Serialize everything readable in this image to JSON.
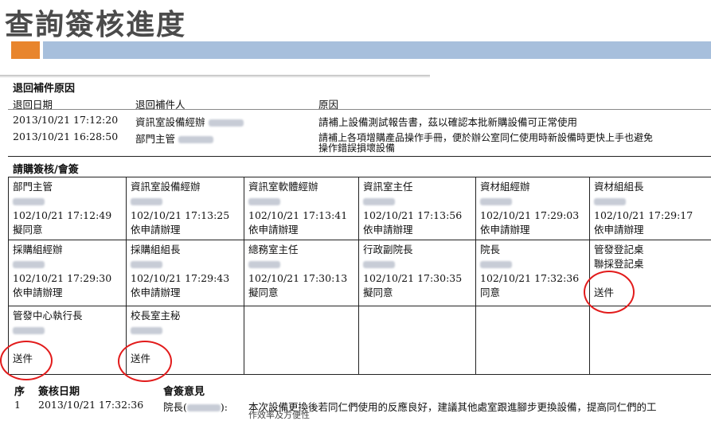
{
  "page_title": "查詢簽核進度",
  "return_section": {
    "heading": "退回補件原因",
    "headers": [
      "退回日期",
      "退回補件人",
      "原因"
    ],
    "rows": [
      {
        "date": "2013/10/21 17:12:20",
        "person": "資訊室設備經辦",
        "reason1": "請補上設備測試報告書，茲以確認本批新購設備可正常使用",
        "reason2": ""
      },
      {
        "date": "2013/10/21 16:28:50",
        "person": "部門主管",
        "reason1": "請補上各項增購產品操作手冊，便於辦公室同仁使用時新設備時更快上手也避免",
        "reason2": "操作錯誤損壞設備"
      }
    ]
  },
  "sign_section": {
    "heading": "請購簽核/會簽",
    "cells": [
      {
        "role": "部門主管",
        "time": "102/10/21 17:12:49",
        "result": "擬同意"
      },
      {
        "role": "資訊室設備經辦",
        "time": "102/10/21 17:13:25",
        "result": "依申請辦理"
      },
      {
        "role": "資訊室軟體經辦",
        "time": "102/10/21 17:13:41",
        "result": "依申請辦理"
      },
      {
        "role": "資訊室主任",
        "time": "102/10/21 17:13:56",
        "result": "依申請辦理"
      },
      {
        "role": "資材組經辦",
        "time": "102/10/21 17:29:03",
        "result": "依申請辦理"
      },
      {
        "role": "資材組組長",
        "time": "102/10/21 17:29:17",
        "result": "依申請辦理"
      },
      {
        "role": "採購組經辦",
        "time": "102/10/21 17:29:30",
        "result": "依申請辦理"
      },
      {
        "role": "採購組組長",
        "time": "102/10/21 17:29:43",
        "result": "依申請辦理"
      },
      {
        "role": "總務室主任",
        "time": "102/10/21 17:30:13",
        "result": "擬同意"
      },
      {
        "role": "行政副院長",
        "time": "102/10/21 17:30:35",
        "result": "擬同意"
      },
      {
        "role": "院長",
        "time": "102/10/21 17:32:36",
        "result": "同意"
      },
      {
        "role": "管發登記桌",
        "role2": "聯採登記桌",
        "result": "送件"
      },
      {
        "role": "管發中心執行長",
        "result": "送件"
      },
      {
        "role": "校長室主秘",
        "result": "送件"
      }
    ]
  },
  "opinion_section": {
    "headers": [
      "序",
      "簽核日期",
      "會簽意見"
    ],
    "rows": [
      {
        "seq": "1",
        "date": "2013/10/21 17:32:36",
        "signer": "院長(",
        "signer_close": "):",
        "opinion": "本次設備更換後若同仁們使用的反應良好，建議其他處室跟進腳步更換設備，提高同仁們的工",
        "opinion2": "作效率及方便性"
      }
    ]
  },
  "colors": {
    "accent": "#e8852d",
    "banner": "#a7bfdc",
    "circle": "#e21b1b"
  }
}
